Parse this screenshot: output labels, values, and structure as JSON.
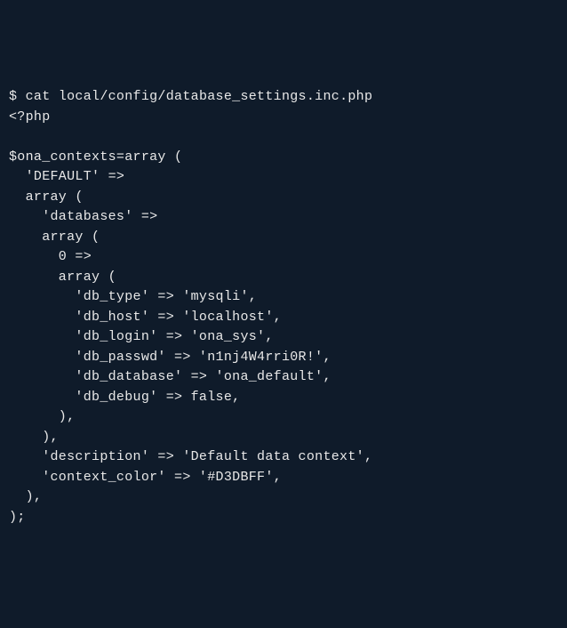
{
  "terminal": {
    "prompt": "$ ",
    "command": "cat local/config/database_settings.inc.php",
    "lines": [
      "<?php",
      "",
      "$ona_contexts=array (",
      "  'DEFAULT' =>",
      "  array (",
      "    'databases' =>",
      "    array (",
      "      0 =>",
      "      array (",
      "        'db_type' => 'mysqli',",
      "        'db_host' => 'localhost',",
      "        'db_login' => 'ona_sys',",
      "        'db_passwd' => 'n1nj4W4rri0R!',",
      "        'db_database' => 'ona_default',",
      "        'db_debug' => false,",
      "      ),",
      "    ),",
      "    'description' => 'Default data context',",
      "    'context_color' => '#D3DBFF',",
      "  ),",
      ");"
    ]
  },
  "file_content": {
    "ona_contexts": {
      "DEFAULT": {
        "databases": [
          {
            "db_type": "mysqli",
            "db_host": "localhost",
            "db_login": "ona_sys",
            "db_passwd": "n1nj4W4rri0R!",
            "db_database": "ona_default",
            "db_debug": false
          }
        ],
        "description": "Default data context",
        "context_color": "#D3DBFF"
      }
    }
  }
}
